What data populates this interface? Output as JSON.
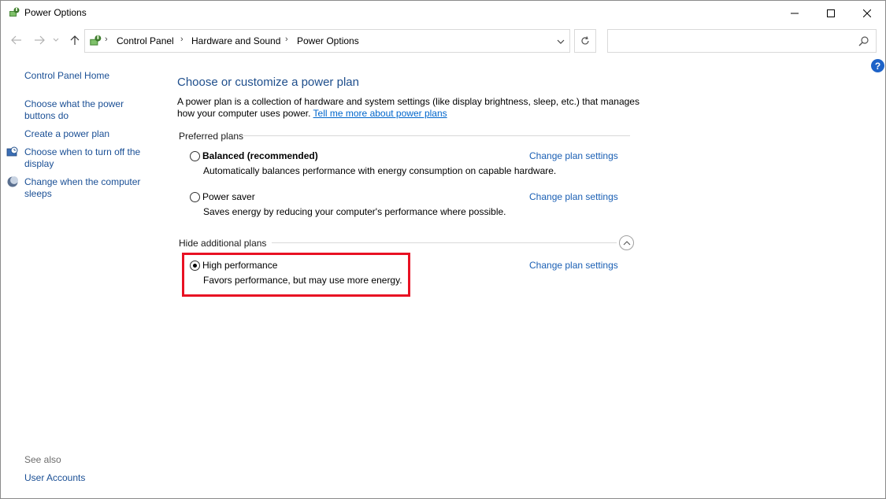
{
  "window": {
    "title": "Power Options",
    "controls": {
      "minimize": "—",
      "maximize": "☐",
      "close": "✕"
    }
  },
  "address": {
    "breadcrumbs": [
      "Control Panel",
      "Hardware and Sound",
      "Power Options"
    ],
    "search_placeholder": ""
  },
  "left_pane": {
    "home": "Control Panel Home",
    "links": [
      "Choose what the power buttons do",
      "Create a power plan",
      "Choose when to turn off the display",
      "Change when the computer sleeps"
    ],
    "see_also_label": "See also",
    "see_also_links": [
      "User Accounts"
    ]
  },
  "main": {
    "title": "Choose or customize a power plan",
    "description_line1": "A power plan is a collection of hardware and system settings (like display brightness, sleep, etc.) that manages",
    "description_line2": "how your computer uses power.",
    "learn_more_link": "Tell me more about power plans",
    "preferred_plans_label": "Preferred plans",
    "additional_plans_label": "Hide additional plans",
    "plans": [
      {
        "name": "Balanced (recommended)",
        "description": "Automatically balances performance with energy consumption on capable hardware.",
        "selected": false,
        "change_label": "Change plan settings"
      },
      {
        "name": "Power saver",
        "description": "Saves energy by reducing your computer's performance where possible.",
        "selected": false,
        "change_label": "Change plan settings"
      },
      {
        "name": "High performance",
        "description": "Favors performance, but may use more energy.",
        "selected": true,
        "change_label": "Change plan settings"
      }
    ]
  },
  "colors": {
    "link": "#1a5fb4",
    "title": "#1e4e8c",
    "highlight": "#e81123"
  },
  "icons": [
    "power-options-icon",
    "back-arrow-icon",
    "forward-arrow-icon",
    "recent-dropdown-icon",
    "up-arrow-icon",
    "refresh-icon",
    "search-icon",
    "help-icon",
    "collapse-chevron-icon"
  ]
}
